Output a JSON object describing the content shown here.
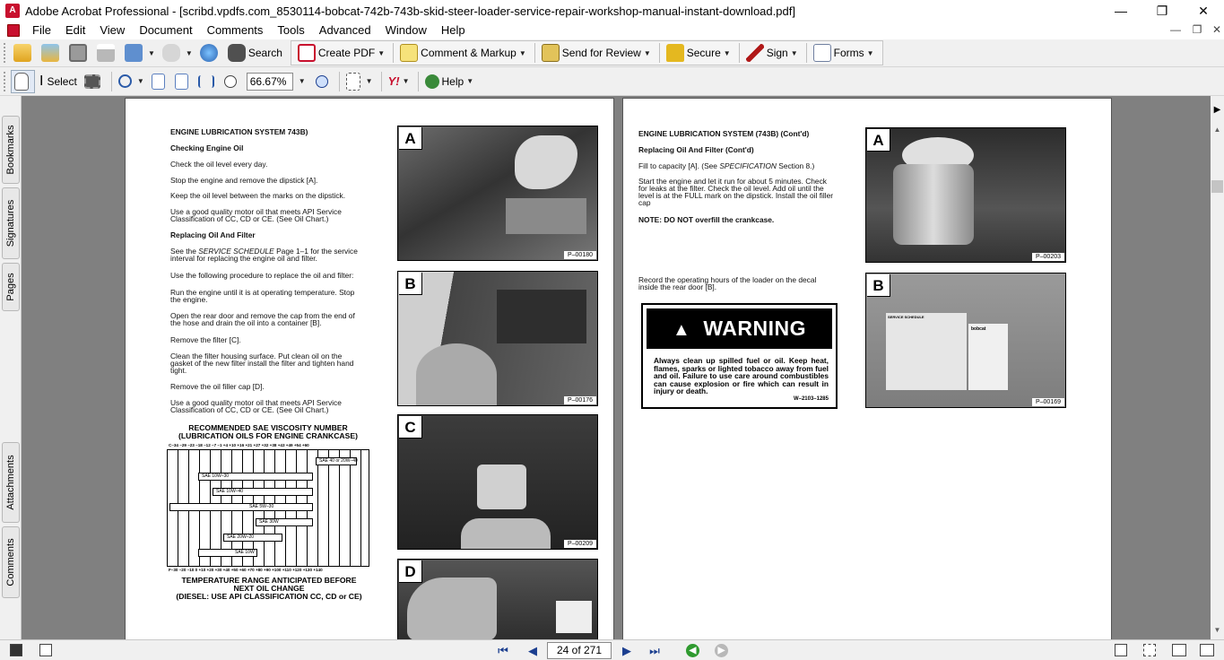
{
  "window": {
    "title": "Adobe Acrobat Professional - [scribd.vpdfs.com_8530114-bobcat-742b-743b-skid-steer-loader-service-repair-workshop-manual-instant-download.pdf]",
    "minimize": "—",
    "maximize": "❐",
    "close": "✕"
  },
  "menu": {
    "items": [
      "File",
      "Edit",
      "View",
      "Document",
      "Comments",
      "Tools",
      "Advanced",
      "Window",
      "Help"
    ],
    "doc_controls": [
      "—",
      "❐",
      "✕"
    ]
  },
  "toolbar1": {
    "search_label": "Search",
    "create_pdf_label": "Create PDF",
    "comment_label": "Comment & Markup",
    "review_label": "Send for Review",
    "secure_label": "Secure",
    "sign_label": "Sign",
    "forms_label": "Forms"
  },
  "toolbar2": {
    "select_label": "Select",
    "zoom_value": "66.67%",
    "help_label": "Help",
    "yahoo_label": "Y!"
  },
  "side_tabs": [
    "Bookmarks",
    "Signatures",
    "Pages",
    "Attachments",
    "Comments"
  ],
  "status": {
    "page_display": "24 of 271"
  },
  "left_page": {
    "heading": "ENGINE LUBRICATION SYSTEM 743B)",
    "sub1": "Checking Engine Oil",
    "p1": "Check the oil level every day.",
    "p2": "Stop the engine and remove the dipstick [A].",
    "p3": "Keep the oil level between the marks on the dipstick.",
    "p4a": "Use a good quality motor oil that meets API Service",
    "p4b": "Classification of CC, CD or CE. (See Oil Chart.)",
    "sub2": "Replacing Oil And Filter",
    "p5a_pre": "See the ",
    "p5a_it": "SERVICE SCHEDULE",
    "p5a_post": " Page 1–1 for the service",
    "p5b": "interval for replacing the engine oil and filter.",
    "p6": "Use the following procedure to replace the oil and filter:",
    "p7a": "Run the engine until it is at operating temperature. Stop",
    "p7b": "the engine.",
    "p8a": "Open the rear door and remove the cap from the end of",
    "p8b": "the hose and drain the oil into a container [B].",
    "p9": "Remove the filter [C].",
    "p10a": "Clean the filter housing surface. Put clean oil on the",
    "p10b": "gasket of the new filter install the filter and tighten hand",
    "p10c": "tight.",
    "p11": "Remove the oil filler cap [D].",
    "p12a": "Use a good quality motor oil that meets API Service",
    "p12b": "Classification of CC, CD or CE. (See Oil Chart.)",
    "chart_title1": "RECOMMENDED SAE VISCOSITY NUMBER",
    "chart_title2": "(LUBRICATION OILS FOR ENGINE CRANKCASE)",
    "chart_c_ticks": "C–34 –29 –23 –18 –12  –7  –1  +4 +10 +16 +21 +27 +32 +38 +43 +49 +54 +60",
    "chart_f_ticks": "F–30 –20 –10   0  +10 +20 +30 +40 +50 +60 +70 +80 +90 +100 +110 +120 +130 +140",
    "chart_bars": [
      "SAE 40 or 20W–40",
      "SAE 10W–30",
      "SAE 10W–40",
      "SAE 5W–30",
      "SAE 30W",
      "SAE 20W–20",
      "SAE 10W"
    ],
    "chart_foot1": "TEMPERATURE RANGE ANTICIPATED BEFORE",
    "chart_foot2": "NEXT OIL CHANGE",
    "chart_foot3": "(DIESEL: USE API CLASSIFICATION CC, CD or CE)",
    "photos": [
      {
        "letter": "A",
        "code": "P–00180"
      },
      {
        "letter": "B",
        "code": "P–00176"
      },
      {
        "letter": "C",
        "code": "P–00209"
      },
      {
        "letter": "D",
        "code": ""
      }
    ]
  },
  "right_page": {
    "heading": "ENGINE LUBRICATION SYSTEM (743B) (Cont'd)",
    "sub1": "Replacing Oil And Filter (Cont'd)",
    "p1_pre": "Fill to capacity [A]. (See ",
    "p1_it": "SPECIFICATION",
    "p1_post": " Section 8.)",
    "p2a": "Start the engine and let it run for about 5 minutes. Check",
    "p2b": "for leaks at the filter. Check the oil level. Add oil until the",
    "p2c": "level is at the FULL mark on the dipstick. Install the oil filler",
    "p2d": "cap",
    "note": "NOTE:  DO NOT overfill the crankcase.",
    "p3a": "Record the operating hours of the loader on the decal",
    "p3b": "inside the rear door [B].",
    "warning_title": "WARNING",
    "warning_body": "Always clean up spilled fuel or oil. Keep heat, flames, sparks or lighted tobacco away from fuel and oil. Failure to use care around combustibles can cause explosion or fire which can result in injury or death.",
    "warning_code": "W–2103–1285",
    "photos": [
      {
        "letter": "A",
        "code": "P–00203"
      },
      {
        "letter": "B",
        "code": "P–00169"
      }
    ],
    "decal_label1": "SERVICE SCHEDULE",
    "decal_label2": "bobcat"
  }
}
